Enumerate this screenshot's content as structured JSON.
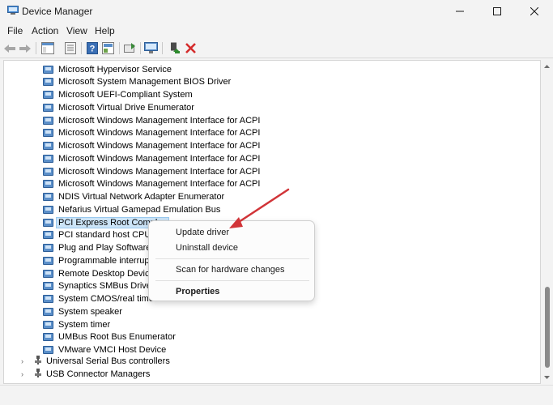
{
  "window": {
    "title": "Device Manager",
    "controls": {
      "minimize": "minimize",
      "maximize": "maximize",
      "close": "close"
    }
  },
  "menu": [
    "File",
    "Action",
    "View",
    "Help"
  ],
  "toolbar": {
    "icons": [
      "back-icon",
      "forward-icon",
      "show-hide-tree-icon",
      "properties-sheet-icon",
      "help-icon",
      "driver-properties-icon",
      "update-driver-icon",
      "scan-hardware-icon",
      "enable-device-icon",
      "uninstall-icon"
    ]
  },
  "devices": [
    "Microsoft Hypervisor Service",
    "Microsoft System Management BIOS Driver",
    "Microsoft UEFI-Compliant System",
    "Microsoft Virtual Drive Enumerator",
    "Microsoft Windows Management Interface for ACPI",
    "Microsoft Windows Management Interface for ACPI",
    "Microsoft Windows Management Interface for ACPI",
    "Microsoft Windows Management Interface for ACPI",
    "Microsoft Windows Management Interface for ACPI",
    "Microsoft Windows Management Interface for ACPI",
    "NDIS Virtual Network Adapter Enumerator",
    "Nefarius Virtual Gamepad Emulation Bus",
    "PCI Express Root Complex",
    "PCI standard host CPU b",
    "Plug and Play Software D",
    "Programmable interrupt",
    "Remote Desktop Device",
    "Synaptics SMBus Driver",
    "System CMOS/real time",
    "System speaker",
    "System timer",
    "UMBus Root Bus Enumerator",
    "VMware VMCI Host Device"
  ],
  "selected_device": "PCI Express Root Complex",
  "categories": [
    {
      "label": "Universal Serial Bus controllers"
    },
    {
      "label": "USB Connector Managers"
    }
  ],
  "context_menu": {
    "update_driver": "Update driver",
    "uninstall_device": "Uninstall device",
    "scan_hardware": "Scan for hardware changes",
    "properties": "Properties"
  },
  "colors": {
    "annotation_arrow": "#d13438",
    "selection_bg": "#cce4f7",
    "selection_border": "#99c9ef"
  }
}
